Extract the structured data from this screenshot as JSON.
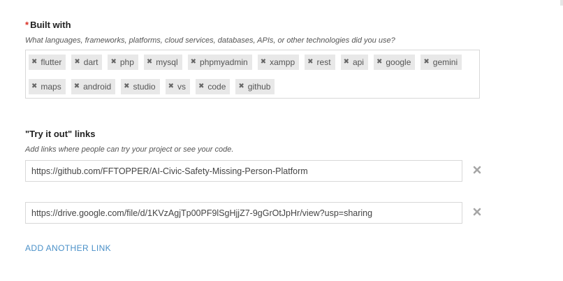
{
  "built_with": {
    "required_marker": "*",
    "title": "Built with",
    "help": "What languages, frameworks, platforms, cloud services, databases, APIs, or other technologies did you use?",
    "remove_glyph": "✖",
    "tags_row1": [
      "flutter",
      "dart",
      "php",
      "mysql",
      "phpmyadmin",
      "xampp",
      "rest",
      "api",
      "google",
      "gemini"
    ],
    "tags_row2": [
      "maps",
      "android",
      "studio",
      "vs",
      "code",
      "github"
    ]
  },
  "try_it_out": {
    "title": "\"Try it out\" links",
    "help": "Add links where people can try your project or see your code.",
    "links": [
      "https://github.com/FFTOPPER/AI-Civic-Safety-Missing-Person-Platform",
      "https://drive.google.com/file/d/1KVzAgjTp00PF9lSgHjjZ7-9gGrOtJpHr/view?usp=sharing"
    ],
    "add_link_label": "ADD ANOTHER LINK"
  },
  "colors": {
    "required": "#d93025",
    "link_accent": "#4a90c8",
    "tag_bg": "#e8e8e8",
    "remove_icon": "#a6a6a6"
  }
}
